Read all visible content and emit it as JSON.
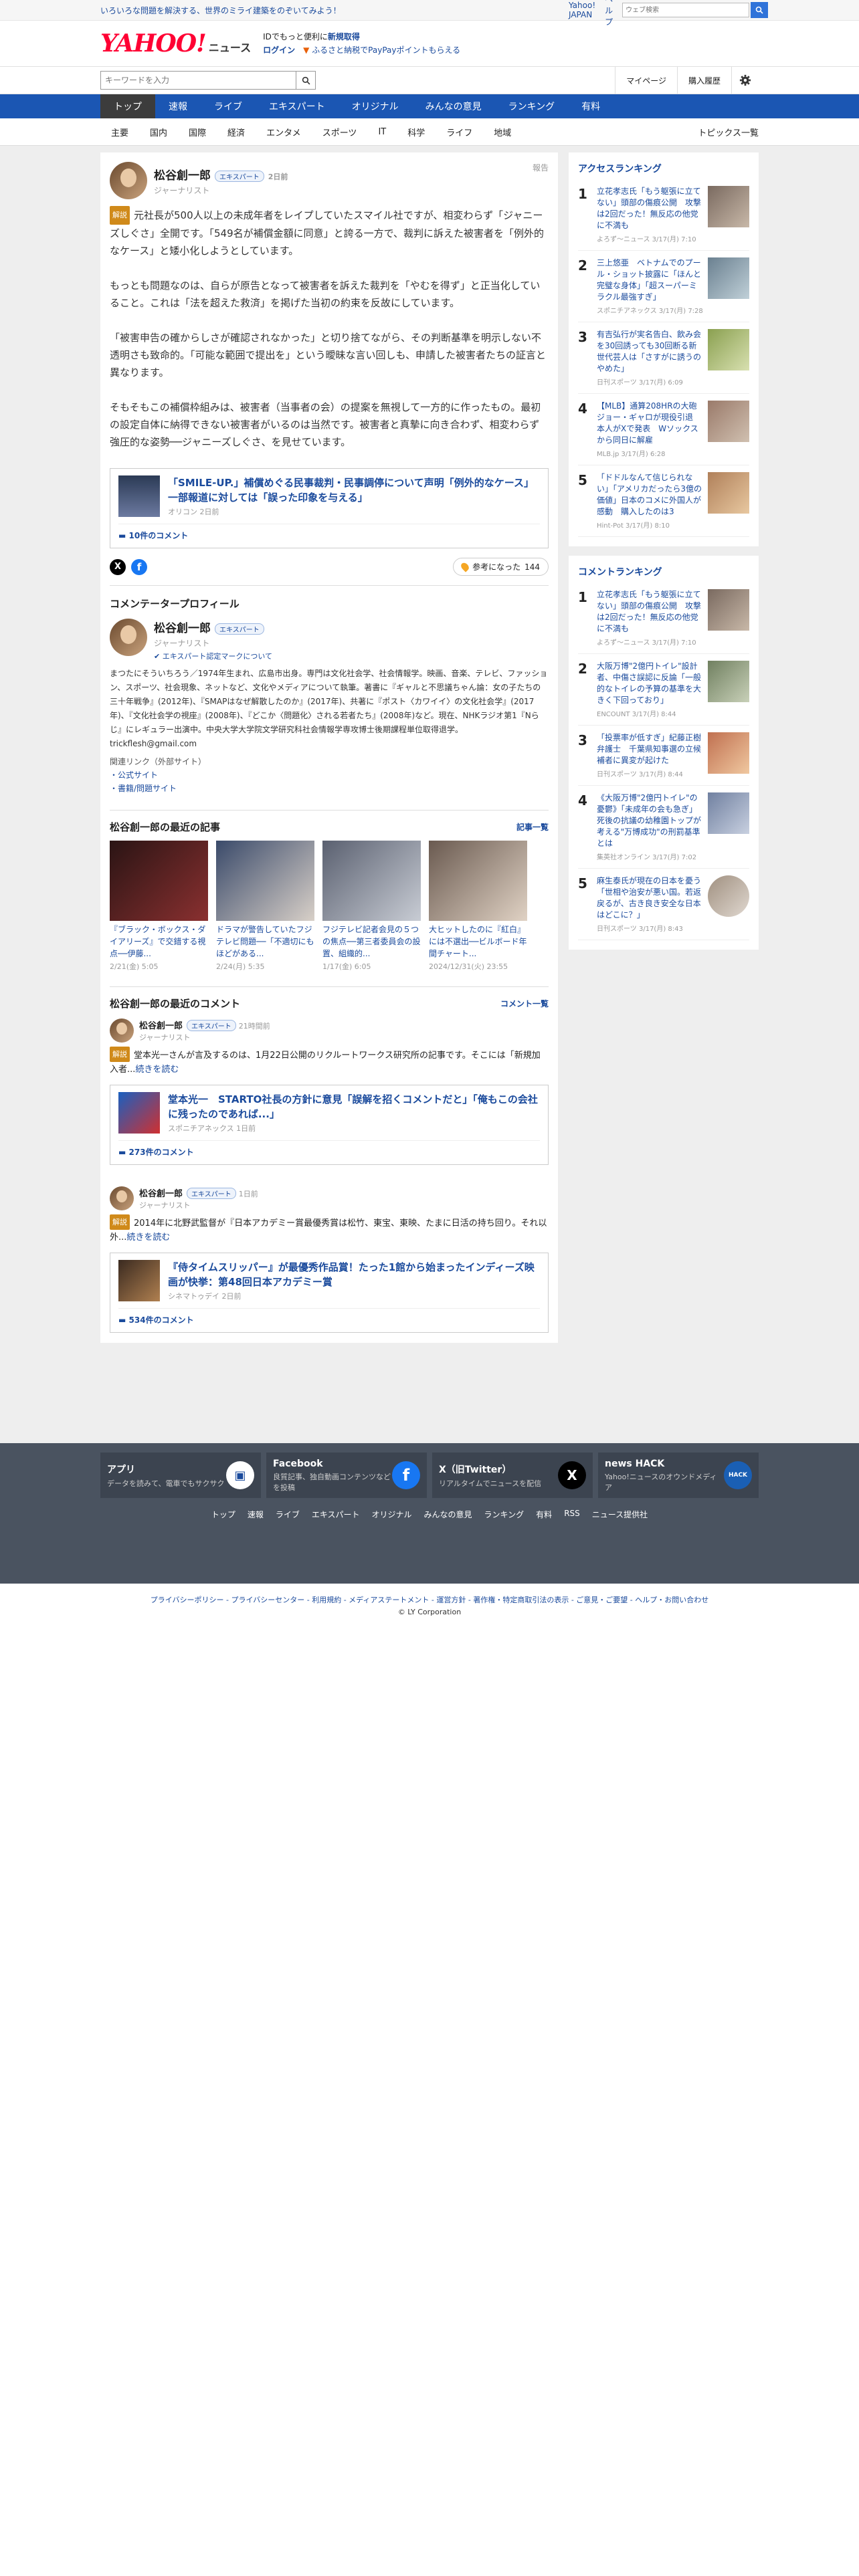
{
  "topbar": {
    "promo": "いろいろな問題を解決する、世界のミライ建築をのぞいてみよう！",
    "links": [
      "Yahoo! JAPAN",
      "ヘルプ"
    ],
    "search_placeholder": "ウェブ検索",
    "search_hint": "キーワードを入力"
  },
  "header": {
    "logo": "YAHOO!",
    "logo_sub": "JAPAN",
    "logo_news": "ニュース",
    "line1": "IDでもっと便利に",
    "line1_link": "新規取得",
    "line2_login": "ログイン",
    "line2_text": "ふるさと納税でPayPayポイントもらえる"
  },
  "searchrow": {
    "placeholder": "キーワードを入力",
    "mypage": "マイページ",
    "history": "購入履歴"
  },
  "mainnav": [
    "トップ",
    "速報",
    "ライブ",
    "エキスパート",
    "オリジナル",
    "みんなの意見",
    "ランキング",
    "有料"
  ],
  "subnav": [
    "主要",
    "国内",
    "国際",
    "経済",
    "エンタメ",
    "スポーツ",
    "IT",
    "科学",
    "ライフ",
    "地域"
  ],
  "subnav_list": "トピックス一覧",
  "comment": {
    "name": "松谷創一郎",
    "badge": "エキスパート",
    "time": "2日前",
    "role": "ジャーナリスト",
    "report": "報告",
    "kaisetsu": "解説",
    "p1": "元社長が500人以上の未成年者をレイプしていたスマイル社ですが、相変わらず「ジャニーズしぐさ」全開です。「549名が補償金額に同意」と誇る一方で、裁判に訴えた被害者を「例外的なケース」と矮小化しようとしています。",
    "p2": "もっとも問題なのは、自らが原告となって被害者を訴えた裁判を「やむを得ず」と正当化していること。これは「法を超えた救済」を掲げた当初の約束を反故にしています。",
    "p3": "「被害申告の確からしさが確認されなかった」と切り捨てながら、その判断基準を明示しない不透明さも致命的。「可能な範囲で提出を」という曖昧な言い回しも、申請した被害者たちの証言と異なります。",
    "p4": "そもそもこの補償枠組みは、被害者（当事者の会）の提案を無視して一方的に作ったもの。最初の設定自体に納得できない被害者がいるのは当然です。被害者と真摯に向き合わず、相変わらず強圧的な姿勢──ジャニーズしぐさ、を見せています。",
    "card": {
      "title": "「SMILE-UP.」補償めぐる民事裁判・民事調停について声明「例外的なケース」一部報道に対しては「誤った印象を与える」",
      "source": "オリコン 2日前",
      "count": "10件のコメント"
    },
    "helpful_label": "参考になった",
    "helpful_count": "144"
  },
  "profile": {
    "section": "コメンテータープロフィール",
    "name": "松谷創一郎",
    "badge": "エキスパート",
    "role": "ジャーナリスト",
    "cert": "エキスパート認定マークについて",
    "bio": "まつたにそういちろう／1974年生まれ、広島市出身。専門は文化社会学、社会情報学。映画、音楽、テレビ、ファッション、スポーツ、社会現象、ネットなど、文化やメディアについて執筆。著書に『ギャルと不思議ちゃん論：女の子たちの三十年戦争』(2012年)、『SMAPはなぜ解散したのか』(2017年)、共著に『ポスト〈カワイイ〉の文化社会学』(2017年)、『文化社会学の視座』(2008年)、『どこか〈問題化〉される若者たち』(2008年)など。現在、NHKラジオ第1『Nらじ』にレギュラー出演中。中央大学大学院文学研究科社会情報学専攻博士後期課程単位取得退学。 trickflesh@gmail.com",
    "links_label": "関連リンク（外部サイト）",
    "links": [
      "公式サイト",
      "書籍/問題サイト"
    ]
  },
  "articles": {
    "section": "松谷創一郎の最近の記事",
    "more": "記事一覧",
    "items": [
      {
        "title": "『ブラック・ボックス・ダイアリーズ』で交錯する視点──伊藤...",
        "date": "2/21(金) 5:05",
        "c1": "#2a1414",
        "c2": "#8a3030"
      },
      {
        "title": "ドラマが警告していたフジテレビ問題──「不適切にもほどがある...",
        "date": "2/24(月) 5:35",
        "c1": "#3a4a6a",
        "c2": "#d8d0c8"
      },
      {
        "title": "フジテレビ記者会見の５つの焦点──第三者委員会の設置、組織的...",
        "date": "1/17(金) 6:05",
        "c1": "#5a6070",
        "c2": "#c8ccd4"
      },
      {
        "title": "大ヒットしたのに『紅白』には不選出──ビルボード年間チャート...",
        "date": "2024/12/31(火) 23:55",
        "c1": "#6a5a50",
        "c2": "#e0d2c4"
      }
    ]
  },
  "recent": {
    "section": "松谷創一郎の最近のコメント",
    "more": "コメント一覧",
    "items": [
      {
        "name": "松谷創一郎",
        "badge": "エキスパート",
        "time": "21時間前",
        "role": "ジャーナリスト",
        "body": "堂本光一さんが言及するのは、1月22日公開のリクルートワークス研究所の記事です。そこには「新規加入者...",
        "readmore": "続きを読む",
        "card_title": "堂本光一　STARTO社長の方針に意見「誤解を招くコメントだと」「俺もこの会社に残ったのであれば...」",
        "card_source": "スポニチアネックス 1日前",
        "card_count": "273件のコメント"
      },
      {
        "name": "松谷創一郎",
        "badge": "エキスパート",
        "time": "1日前",
        "role": "ジャーナリスト",
        "body": "2014年に北野武監督が『日本アカデミー賞最優秀賞は松竹、東宝、東映、たまに日活の持ち回り。それ以外...",
        "readmore": "続きを読む",
        "card_title": "『侍タイムスリッパー』が最優秀作品賞！たった1館から始まったインディーズ映画が快挙：第48回日本アカデミー賞",
        "card_source": "シネマトゥデイ 2日前",
        "card_count": "534件のコメント"
      }
    ]
  },
  "access_ranking": {
    "title": "アクセスランキング",
    "items": [
      {
        "n": "1",
        "t": "立花孝志氏「もう躯張に立てない」頭部の傷痕公開　攻撃は2回だった！無反応の他党に不満も",
        "s": "よろず～ニュース 3/17(月) 7:10",
        "c": "#7a6a60"
      },
      {
        "n": "2",
        "t": "三上悠亜　ベトナムでのプール・ショット披露に「ほんと完璧な身体」「超スーパーミラクル最強すぎ」",
        "s": "スポニチアネックス 3/17(月) 7:28",
        "c": "#6a8090"
      },
      {
        "n": "3",
        "t": "有吉弘行が実名告白、飲み会を30回誘っても30回断る新世代芸人は「さすがに誘うのやめた」",
        "s": "日刊スポーツ 3/17(月) 6:09",
        "c": "#8aa050"
      },
      {
        "n": "4",
        "t": "【MLB】通算208HRの大砲ジョー・ギャロが現役引退　本人がXで発表　Wソックスから同日に解雇",
        "s": "MLB.jp 3/17(月) 6:28",
        "c": "#9a7a6a"
      },
      {
        "n": "5",
        "t": "「ドドルなんて信じられない」「アメリカだったら3億の価値」日本のコメに外国人が感動　購入したのは3",
        "s": "Hint-Pot 3/17(月) 8:10",
        "c": "#b0805a"
      }
    ]
  },
  "comment_ranking": {
    "title": "コメントランキング",
    "items": [
      {
        "n": "1",
        "t": "立花孝志氏「もう躯張に立てない」頭部の傷痕公開　攻撃は2回だった！無反応の他党に不満も",
        "s": "よろず～ニュース 3/17(月) 7:10",
        "c": "#7a6a60"
      },
      {
        "n": "2",
        "t": "大阪万博\"2億円トイレ\"設計者、中傷さ誤認に反論「一般的なトイレの予算の基準を大きく下回っており」",
        "s": "ENCOUNT 3/17(月) 8:44",
        "c": "#708060"
      },
      {
        "n": "3",
        "t": "「投票率が低すぎ」紀藤正樹弁護士　千葉県知事選の立候補者に異変が起けた",
        "s": "日刊スポーツ 3/17(月) 8:44",
        "c": "#c07050"
      },
      {
        "n": "4",
        "t": "《大阪万博\"2億円トイレ\"の憂鬱》「未成年の会も急ぎ」死後の抗議の幼稚園トップが考える\"万博成功\"の刑罰基準とは",
        "s": "集英社オンライン 3/17(月) 7:02",
        "c": "#7080a0"
      },
      {
        "n": "5",
        "t": "麻生泰氏が現在の日本を憂う「世相や治安が悪い国。若返戻るが、古き良き安全な日本はどこに？」",
        "s": "日刊スポーツ 3/17(月) 8:43",
        "c": "#a09080"
      }
    ]
  },
  "footer": {
    "apps": [
      {
        "title": "アプリ",
        "desc": "データを読みて、電車でもサクサク",
        "icon": "app-icon"
      },
      {
        "title": "Facebook",
        "desc": "良質記事、独自動画コンテンツなどを投稿",
        "icon": "facebook-icon"
      },
      {
        "title": "X（旧Twitter）",
        "desc": "リアルタイムでニュースを配信",
        "icon": "x-icon"
      },
      {
        "title": "news HACK",
        "desc": "Yahoo!ニュースのオウンドメディア",
        "icon": "newshack-icon"
      }
    ],
    "nav": [
      "トップ",
      "速報",
      "ライブ",
      "エキスパート",
      "オリジナル",
      "みんなの意見",
      "ランキング",
      "有料",
      "RSS",
      "ニュース提供社"
    ],
    "links": "プライバシーポリシー - プライバシーセンター - 利用規約 - メディアステートメント - 運営方針 - 著作権・特定商取引法の表示 - ご意見・ご要望 - ヘルプ・お問い合わせ",
    "copyright": "© LY Corporation"
  }
}
